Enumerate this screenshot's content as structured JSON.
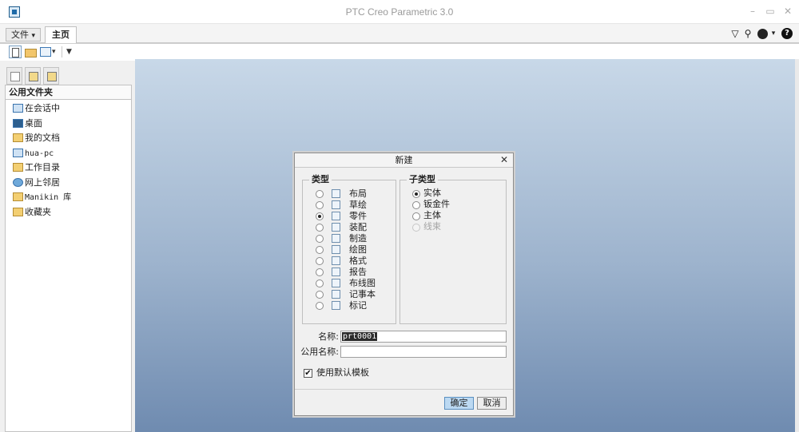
{
  "window": {
    "title": "PTC Creo Parametric 3.0",
    "controls": {
      "minimize": "–",
      "restore": "▭",
      "close": "✕"
    }
  },
  "ribbon": {
    "file_menu": "文件",
    "file_caret": "▾",
    "home_tab": "主页",
    "right_icons": {
      "dropdown": "▽",
      "search": "⚲",
      "style_caret": "▾",
      "help": "?"
    }
  },
  "toolbar": {
    "customize_caret": "▼",
    "window_caret": "▾"
  },
  "left_panel": {
    "header": "公用文件夹",
    "items": [
      {
        "label": "在会话中",
        "icon": "session-icon"
      },
      {
        "label": "桌面",
        "icon": "desktop-icon"
      },
      {
        "label": "我的文档",
        "icon": "documents-icon"
      },
      {
        "label": "hua-pc",
        "icon": "computer-icon"
      },
      {
        "label": "工作目录",
        "icon": "working-directory-icon"
      },
      {
        "label": "网上邻居",
        "icon": "network-icon"
      },
      {
        "label": "Manikin 库",
        "icon": "manikin-library-icon"
      },
      {
        "label": "收藏夹",
        "icon": "favorites-icon"
      }
    ]
  },
  "dialog": {
    "title": "新建",
    "close": "✕",
    "type_group": {
      "title": "类型",
      "items": [
        {
          "label": "布局",
          "selected": false
        },
        {
          "label": "草绘",
          "selected": false
        },
        {
          "label": "零件",
          "selected": true
        },
        {
          "label": "装配",
          "selected": false
        },
        {
          "label": "制造",
          "selected": false
        },
        {
          "label": "绘图",
          "selected": false
        },
        {
          "label": "格式",
          "selected": false
        },
        {
          "label": "报告",
          "selected": false
        },
        {
          "label": "布线图",
          "selected": false
        },
        {
          "label": "记事本",
          "selected": false
        },
        {
          "label": "标记",
          "selected": false
        }
      ]
    },
    "subtype_group": {
      "title": "子类型",
      "items": [
        {
          "label": "实体",
          "selected": true,
          "disabled": false
        },
        {
          "label": "钣金件",
          "selected": false,
          "disabled": false
        },
        {
          "label": "主体",
          "selected": false,
          "disabled": false
        },
        {
          "label": "线束",
          "selected": false,
          "disabled": true
        }
      ]
    },
    "name_label": "名称:",
    "name_value": "prt0001",
    "common_name_label": "公用名称:",
    "common_name_value": "",
    "use_default_template_label": "使用默认模板",
    "use_default_template_checked": true,
    "check_mark": "✔",
    "ok_label": "确定",
    "cancel_label": "取消"
  }
}
